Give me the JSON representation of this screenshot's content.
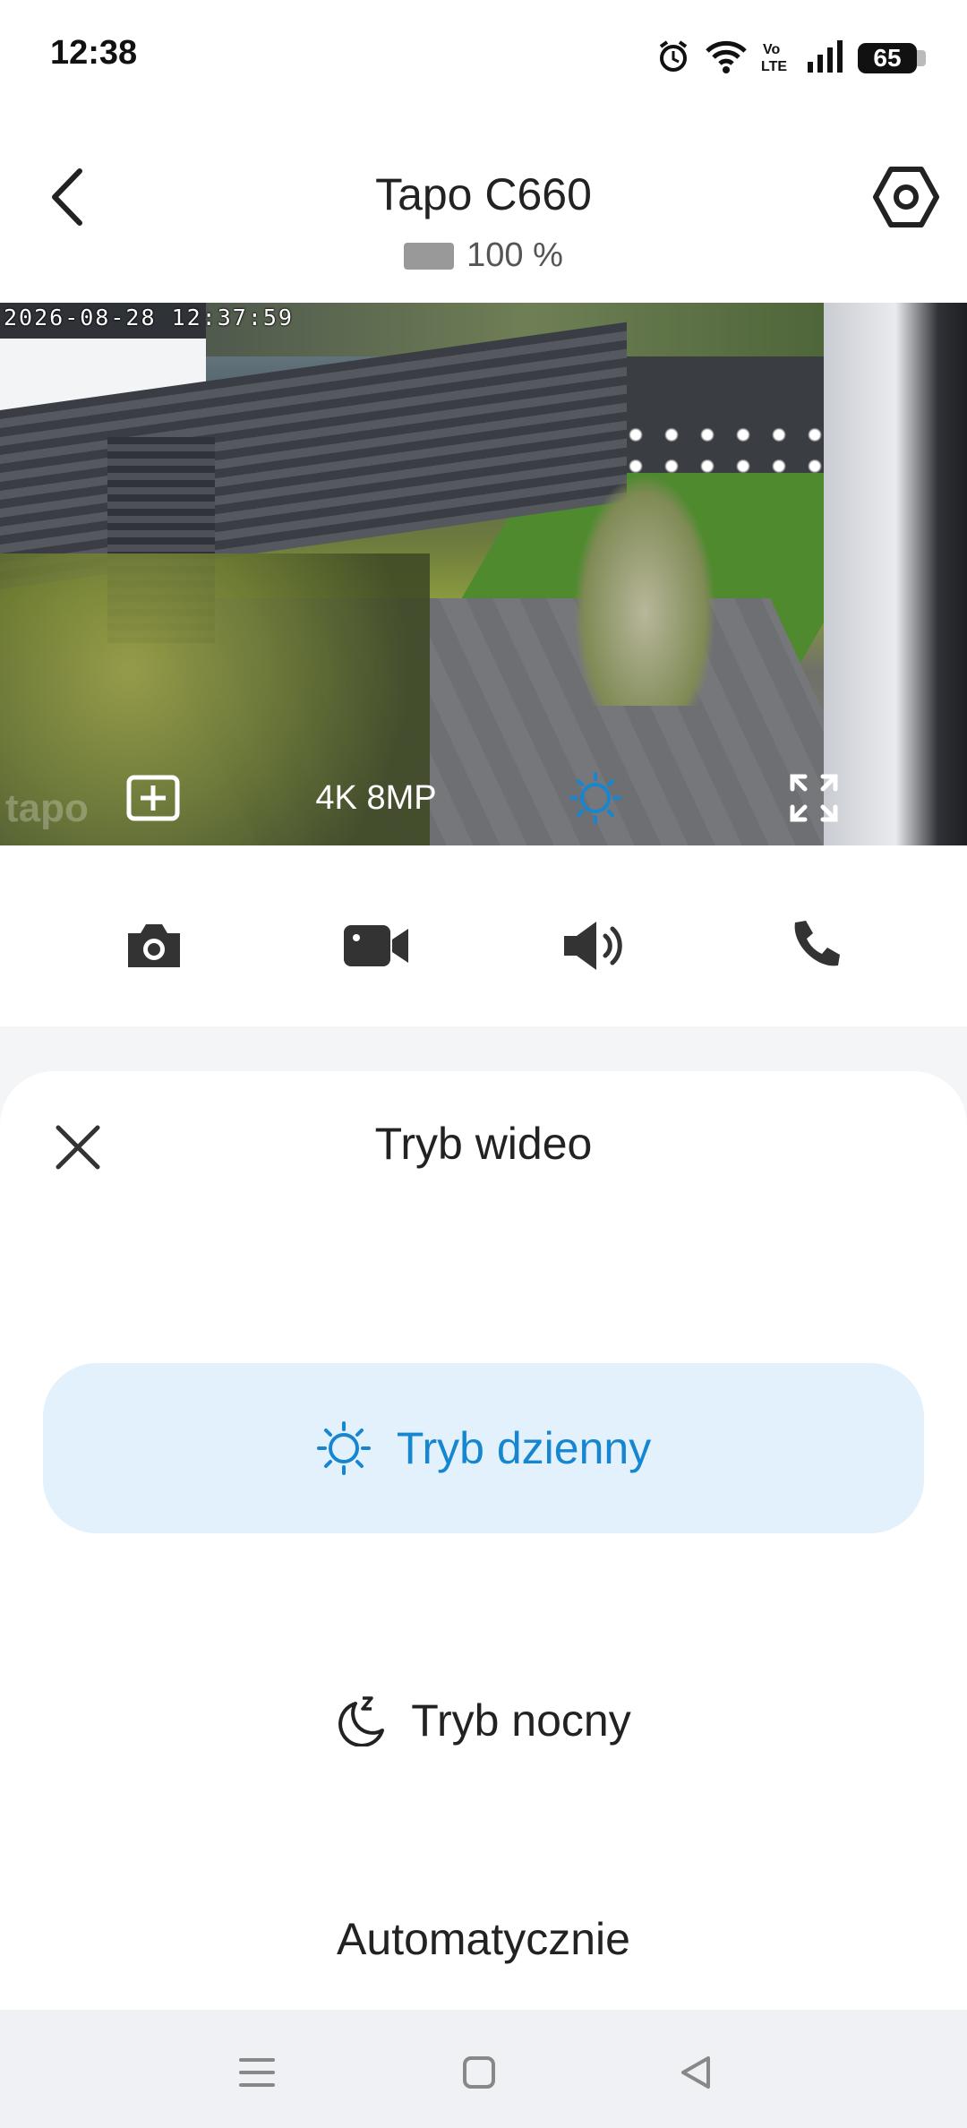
{
  "status_bar": {
    "time": "12:38",
    "battery_level": "65",
    "icons": [
      "alarm-icon",
      "wifi-icon",
      "volte-icon",
      "signal-icon",
      "battery-icon"
    ]
  },
  "header": {
    "title": "Tapo C660",
    "battery_percent": "100 %",
    "back_icon": "back-arrow-icon",
    "settings_icon": "settings-hex-icon"
  },
  "video": {
    "timestamp": "2026-08-28 12:37:59",
    "watermark": "tapo",
    "resolution_label": "4K 8MP",
    "toolbar_icons": [
      "add-view-icon",
      "sun-icon",
      "fullscreen-icon"
    ],
    "accent": "#1686d1"
  },
  "actions": {
    "icons": [
      "camera-icon",
      "video-record-icon",
      "speaker-icon",
      "phone-icon"
    ]
  },
  "sheet": {
    "title": "Tryb wideo",
    "close_icon": "close-icon",
    "options": [
      {
        "label": "Tryb dzienny",
        "icon": "sun-icon",
        "selected": true
      },
      {
        "label": "Tryb nocny",
        "icon": "moon-icon",
        "selected": false
      },
      {
        "label": "Automatycznie",
        "icon": "",
        "selected": false
      }
    ],
    "selected_bg": "#e2f1fb"
  },
  "navbar": {
    "icons": [
      "menu-icon",
      "home-square-icon",
      "back-triangle-icon"
    ]
  }
}
